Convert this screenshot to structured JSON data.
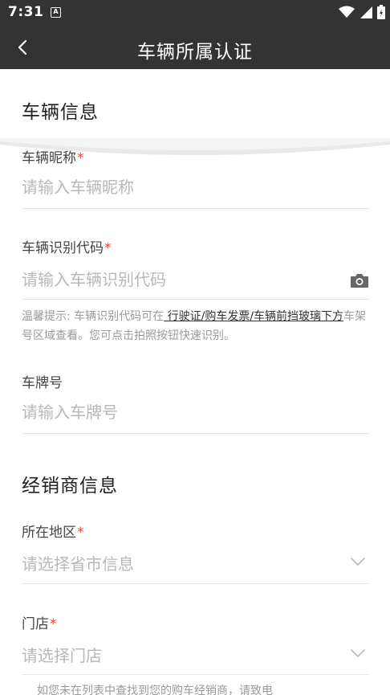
{
  "status_bar": {
    "time": "7:31",
    "notification_icon": "A"
  },
  "app_bar": {
    "back_icon": "chevron-left",
    "title": "车辆所属认证"
  },
  "vehicle_section": {
    "title": "车辆信息",
    "nickname": {
      "label": "车辆昵称",
      "required_mark": "*",
      "placeholder": "请输入车辆昵称",
      "value": ""
    },
    "vin": {
      "label": "车辆识别代码",
      "required_mark": "*",
      "placeholder": "请输入车辆识别代码",
      "value": "",
      "camera_icon": "camera-icon"
    },
    "hint": {
      "prefix": "温馨提示: 车辆识别代码可在",
      "link": " 行驶证/购车发票/车辆前挡玻璃下方",
      "suffix": "车架号区域查看。您可点击拍照按钮快速识别。"
    },
    "plate": {
      "label": "车牌号",
      "placeholder": "请输入车牌号",
      "value": ""
    }
  },
  "dealer_section": {
    "title": "经销商信息",
    "region": {
      "label": "所在地区",
      "required_mark": "*",
      "placeholder": "请选择省市信息"
    },
    "store": {
      "label": "门店",
      "required_mark": "*",
      "placeholder": "请选择门店"
    },
    "footer_note": "如您未在列表中查找到您的购车经销商，请致电"
  },
  "colors": {
    "bar_bg": "#333333",
    "required": "#e0463a",
    "placeholder": "#b8b8b8",
    "divider": "#e6e6e6"
  }
}
